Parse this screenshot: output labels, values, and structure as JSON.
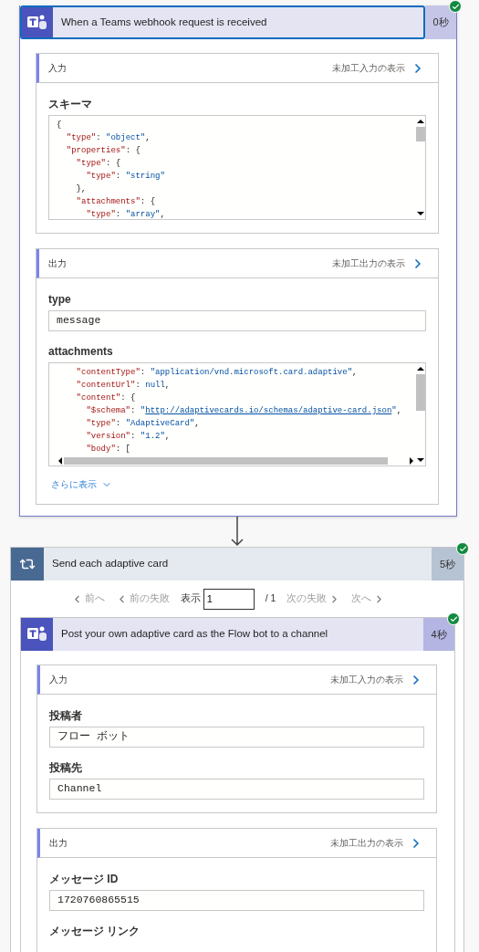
{
  "trigger": {
    "title": "When a Teams webhook request is received",
    "duration": "0秒",
    "succeeded": true,
    "selected": true,
    "sections": [
      {
        "title": "入力",
        "raw_link": "未加工入力の表示",
        "fields": [
          {
            "label": "スキーマ",
            "kind": "code",
            "lines": [
              [
                {
                  "kind": "punct",
                  "text": "{"
                }
              ],
              [
                {
                  "kind": "key",
                  "text": "  \"type\""
                },
                {
                  "kind": "punct",
                  "text": ": "
                },
                {
                  "kind": "string",
                  "text": "\"object\""
                },
                {
                  "kind": "punct",
                  "text": ","
                }
              ],
              [
                {
                  "kind": "key",
                  "text": "  \"properties\""
                },
                {
                  "kind": "punct",
                  "text": ": {"
                }
              ],
              [
                {
                  "kind": "key",
                  "text": "    \"type\""
                },
                {
                  "kind": "punct",
                  "text": ": {"
                }
              ],
              [
                {
                  "kind": "key",
                  "text": "      \"type\""
                },
                {
                  "kind": "punct",
                  "text": ": "
                },
                {
                  "kind": "string",
                  "text": "\"string\""
                }
              ],
              [
                {
                  "kind": "punct",
                  "text": "    },"
                }
              ],
              [
                {
                  "kind": "key",
                  "text": "    \"attachments\""
                },
                {
                  "kind": "punct",
                  "text": ": {"
                }
              ],
              [
                {
                  "kind": "key",
                  "text": "      \"type\""
                },
                {
                  "kind": "punct",
                  "text": ": "
                },
                {
                  "kind": "string",
                  "text": "\"array\""
                },
                {
                  "kind": "punct",
                  "text": ","
                }
              ]
            ]
          }
        ]
      },
      {
        "title": "出力",
        "raw_link": "未加工出力の表示",
        "show_more": "さらに表示",
        "fields": [
          {
            "label": "type",
            "kind": "text",
            "value": "message"
          },
          {
            "label": "attachments",
            "kind": "code",
            "lines": [
              [
                {
                  "kind": "key",
                  "text": "    \"contentType\""
                },
                {
                  "kind": "punct",
                  "text": ": "
                },
                {
                  "kind": "string",
                  "text": "\"application/vnd.microsoft.card.adaptive\""
                },
                {
                  "kind": "punct",
                  "text": ","
                }
              ],
              [
                {
                  "kind": "key",
                  "text": "    \"contentUrl\""
                },
                {
                  "kind": "punct",
                  "text": ": "
                },
                {
                  "kind": "literal",
                  "text": "null"
                },
                {
                  "kind": "punct",
                  "text": ","
                }
              ],
              [
                {
                  "kind": "key",
                  "text": "    \"content\""
                },
                {
                  "kind": "punct",
                  "text": ": {"
                }
              ],
              [
                {
                  "kind": "key",
                  "text": "      \"$schema\""
                },
                {
                  "kind": "punct",
                  "text": ": "
                },
                {
                  "kind": "string",
                  "text": "\""
                },
                {
                  "kind": "link",
                  "text": "http://adaptivecards.io/schemas/adaptive-card.json"
                },
                {
                  "kind": "string",
                  "text": "\""
                },
                {
                  "kind": "punct",
                  "text": ","
                }
              ],
              [
                {
                  "kind": "key",
                  "text": "      \"type\""
                },
                {
                  "kind": "punct",
                  "text": ": "
                },
                {
                  "kind": "string",
                  "text": "\"AdaptiveCard\""
                },
                {
                  "kind": "punct",
                  "text": ","
                }
              ],
              [
                {
                  "kind": "key",
                  "text": "      \"version\""
                },
                {
                  "kind": "punct",
                  "text": ": "
                },
                {
                  "kind": "string",
                  "text": "\"1.2\""
                },
                {
                  "kind": "punct",
                  "text": ","
                }
              ],
              [
                {
                  "kind": "key",
                  "text": "      \"body\""
                },
                {
                  "kind": "punct",
                  "text": ": ["
                }
              ]
            ]
          }
        ]
      }
    ]
  },
  "loop": {
    "title": "Send each adaptive card",
    "duration": "5秒",
    "succeeded": true,
    "pager": {
      "prev": {
        "label": "前へ",
        "disabled": true
      },
      "prev_failed": {
        "label": "前の失敗",
        "disabled": true
      },
      "show_label": "表示",
      "value": "1",
      "total": "/ 1",
      "next_failed": {
        "label": "次の失敗",
        "disabled": true
      },
      "next": {
        "label": "次へ",
        "disabled": true
      }
    },
    "action": {
      "title": "Post your own adaptive card as the Flow bot to a channel",
      "duration": "4秒",
      "succeeded": true,
      "selected": false,
      "sections": [
        {
          "title": "入力",
          "raw_link": "未加工入力の表示",
          "fields": [
            {
              "label": "投稿者",
              "kind": "text",
              "value": "フロー ボット"
            },
            {
              "label": "投稿先",
              "kind": "text",
              "value": "Channel"
            }
          ]
        },
        {
          "title": "出力",
          "raw_link": "未加工出力の表示",
          "fields": [
            {
              "label": "メッセージ ID",
              "kind": "text",
              "value": "1720760865515"
            },
            {
              "label": "メッセージ リンク",
              "kind": "text"
            }
          ]
        }
      ]
    }
  }
}
